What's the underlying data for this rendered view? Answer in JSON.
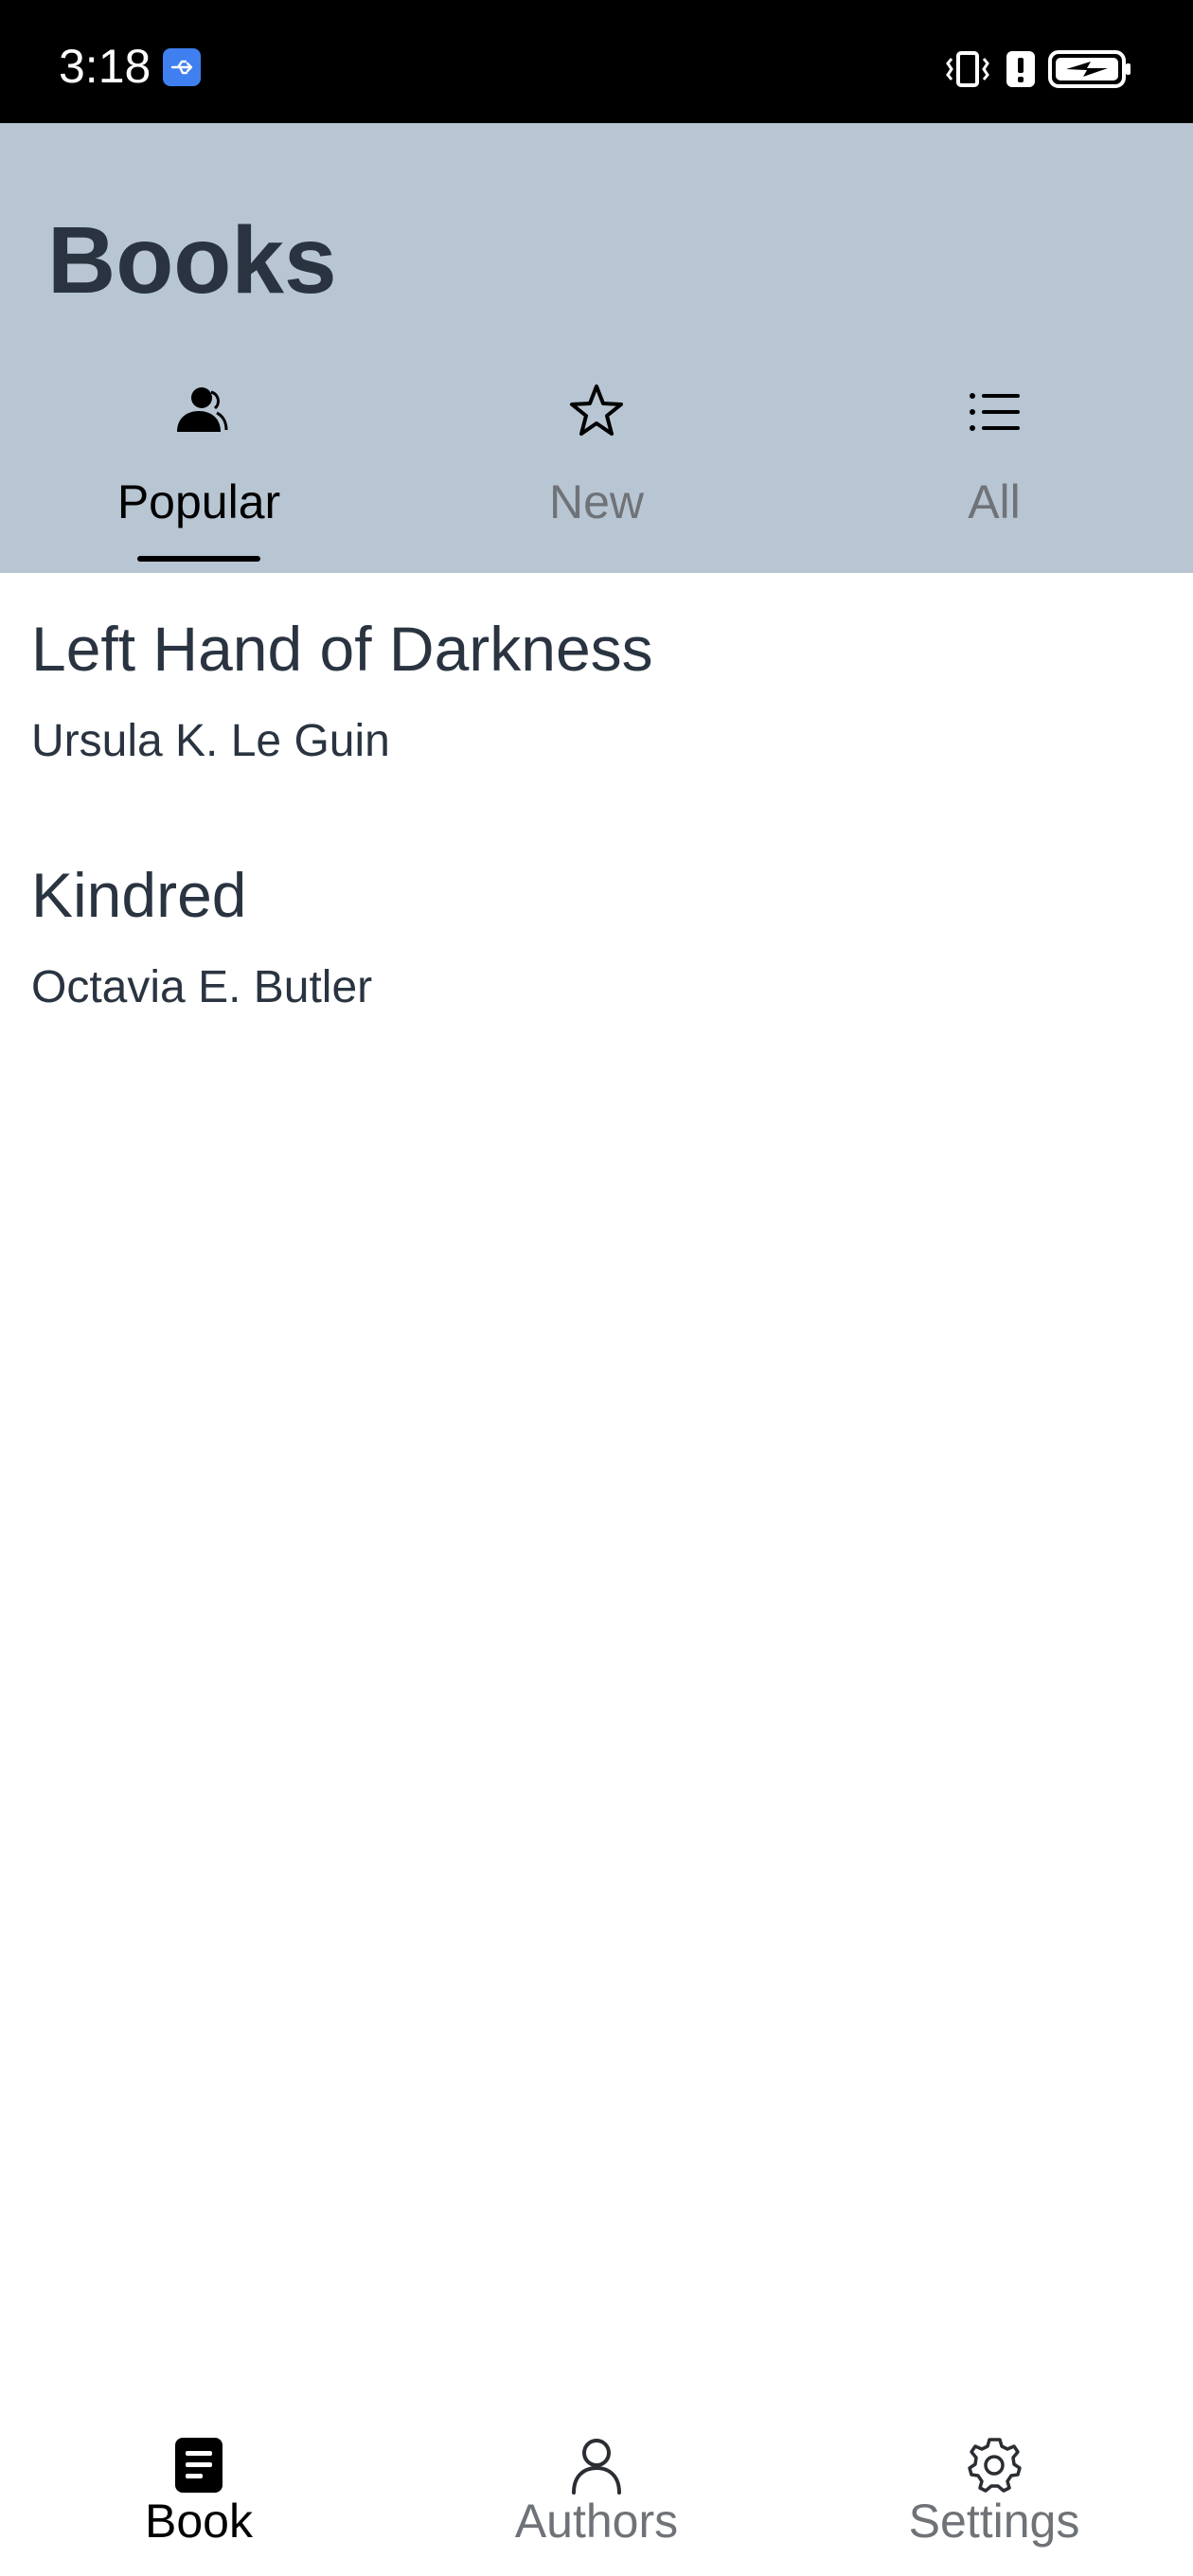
{
  "status_bar": {
    "time": "3:18",
    "icons": [
      "usb-debug-icon",
      "vibrate-icon",
      "alert-icon",
      "battery-charging-icon"
    ]
  },
  "header": {
    "title": "Books",
    "background": "#b8c5d2",
    "text_color": "#2a3441"
  },
  "tabs": [
    {
      "label": "Popular",
      "icon": "person-icon",
      "selected": true,
      "color": "#000000"
    },
    {
      "label": "New",
      "icon": "star-icon",
      "selected": false,
      "color": "#6f7378"
    },
    {
      "label": "All",
      "icon": "list-icon",
      "selected": false,
      "color": "#6f7378"
    }
  ],
  "books": [
    {
      "title": "Left Hand of Darkness",
      "author": "Ursula K. Le Guin"
    },
    {
      "title": "Kindred",
      "author": "Octavia E. Butler"
    }
  ],
  "bottom_nav": [
    {
      "label": "Book",
      "icon": "book-icon",
      "selected": true,
      "color": "#000000"
    },
    {
      "label": "Authors",
      "icon": "person-outline-icon",
      "selected": false,
      "color": "#6f7378"
    },
    {
      "label": "Settings",
      "icon": "gear-icon",
      "selected": false,
      "color": "#6f7378"
    }
  ]
}
